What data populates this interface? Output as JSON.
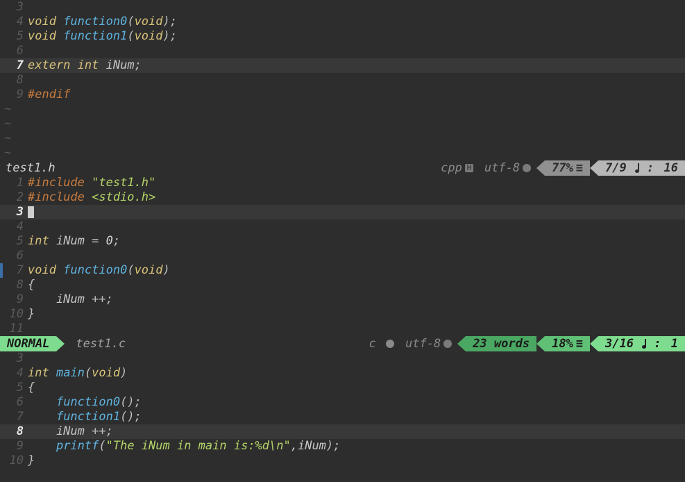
{
  "pane1": {
    "filename": "test1.h",
    "filetype": "cpp",
    "encoding": "utf-8",
    "percent": "77%",
    "position": "7/9",
    "col": "16",
    "current_line": 7,
    "lines": [
      {
        "n": 3,
        "tokens": []
      },
      {
        "n": 4,
        "tokens": [
          {
            "t": "void ",
            "c": "kw-storage"
          },
          {
            "t": "function0",
            "c": "kw-fn"
          },
          {
            "t": "(",
            "c": "paren"
          },
          {
            "t": "void",
            "c": "kw-storage"
          },
          {
            "t": ");",
            "c": "punct"
          }
        ]
      },
      {
        "n": 5,
        "tokens": [
          {
            "t": "void ",
            "c": "kw-storage"
          },
          {
            "t": "function1",
            "c": "kw-fn"
          },
          {
            "t": "(",
            "c": "paren"
          },
          {
            "t": "void",
            "c": "kw-storage"
          },
          {
            "t": ");",
            "c": "punct"
          }
        ]
      },
      {
        "n": 6,
        "tokens": []
      },
      {
        "n": 7,
        "hl": true,
        "tokens": [
          {
            "t": "extern ",
            "c": "kw-storage"
          },
          {
            "t": "int ",
            "c": "kw-storage"
          },
          {
            "t": "iNum",
            "c": "ident"
          },
          {
            "t": ";",
            "c": "punct"
          }
        ]
      },
      {
        "n": 8,
        "tokens": []
      },
      {
        "n": 9,
        "tokens": [
          {
            "t": "#endif",
            "c": "preproc"
          }
        ]
      }
    ]
  },
  "pane2": {
    "mode": "NORMAL",
    "filename": "test1.c",
    "filetype": "c",
    "encoding": "utf-8",
    "words": "23 words",
    "percent": "18%",
    "position": "3/16",
    "col": "1",
    "current_line": 3,
    "lines": [
      {
        "n": 1,
        "tokens": [
          {
            "t": "#include ",
            "c": "preproc"
          },
          {
            "t": "\"test1.h\"",
            "c": "string"
          }
        ]
      },
      {
        "n": 2,
        "tokens": [
          {
            "t": "#include ",
            "c": "preproc"
          },
          {
            "t": "<stdio.h>",
            "c": "string"
          }
        ]
      },
      {
        "n": 3,
        "hl": true,
        "cursor": true,
        "tokens": []
      },
      {
        "n": 4,
        "tokens": []
      },
      {
        "n": 5,
        "tokens": [
          {
            "t": "int ",
            "c": "kw-storage"
          },
          {
            "t": "iNum ",
            "c": "ident"
          },
          {
            "t": "= ",
            "c": "punct"
          },
          {
            "t": "0",
            "c": "num"
          },
          {
            "t": ";",
            "c": "punct"
          }
        ]
      },
      {
        "n": 6,
        "tokens": []
      },
      {
        "n": 7,
        "marker": true,
        "tokens": [
          {
            "t": "void ",
            "c": "kw-storage"
          },
          {
            "t": "function0",
            "c": "kw-fn"
          },
          {
            "t": "(",
            "c": "paren"
          },
          {
            "t": "void",
            "c": "kw-storage"
          },
          {
            "t": ")",
            "c": "paren"
          }
        ]
      },
      {
        "n": 8,
        "tokens": [
          {
            "t": "{",
            "c": "punct"
          }
        ]
      },
      {
        "n": 9,
        "tokens": [
          {
            "t": "    iNum ",
            "c": "ident"
          },
          {
            "t": "++;",
            "c": "punct"
          }
        ]
      },
      {
        "n": 10,
        "tokens": [
          {
            "t": "}",
            "c": "punct"
          }
        ]
      },
      {
        "n": 11,
        "tokens": []
      }
    ]
  },
  "pane3": {
    "current_line": 8,
    "lines": [
      {
        "n": 3,
        "tokens": []
      },
      {
        "n": 4,
        "tokens": [
          {
            "t": "int ",
            "c": "kw-storage"
          },
          {
            "t": "main",
            "c": "kw-fn"
          },
          {
            "t": "(",
            "c": "paren"
          },
          {
            "t": "void",
            "c": "kw-storage"
          },
          {
            "t": ")",
            "c": "paren"
          }
        ]
      },
      {
        "n": 5,
        "tokens": [
          {
            "t": "{",
            "c": "punct"
          }
        ]
      },
      {
        "n": 6,
        "tokens": [
          {
            "t": "    ",
            "c": ""
          },
          {
            "t": "function0",
            "c": "kw-fn"
          },
          {
            "t": "();",
            "c": "punct"
          }
        ]
      },
      {
        "n": 7,
        "tokens": [
          {
            "t": "    ",
            "c": ""
          },
          {
            "t": "function1",
            "c": "kw-fn"
          },
          {
            "t": "();",
            "c": "punct"
          }
        ]
      },
      {
        "n": 8,
        "hl": true,
        "tokens": [
          {
            "t": "    iNum ",
            "c": "ident"
          },
          {
            "t": "++;",
            "c": "punct"
          }
        ]
      },
      {
        "n": 9,
        "tokens": [
          {
            "t": "    ",
            "c": ""
          },
          {
            "t": "printf",
            "c": "kw-fn"
          },
          {
            "t": "(",
            "c": "paren"
          },
          {
            "t": "\"The iNum in main is:%d\\n\"",
            "c": "string"
          },
          {
            "t": ",iNum",
            "c": "ident"
          },
          {
            "t": ");",
            "c": "punct"
          }
        ]
      },
      {
        "n": 10,
        "tokens": [
          {
            "t": "}",
            "c": "punct"
          }
        ]
      }
    ]
  }
}
